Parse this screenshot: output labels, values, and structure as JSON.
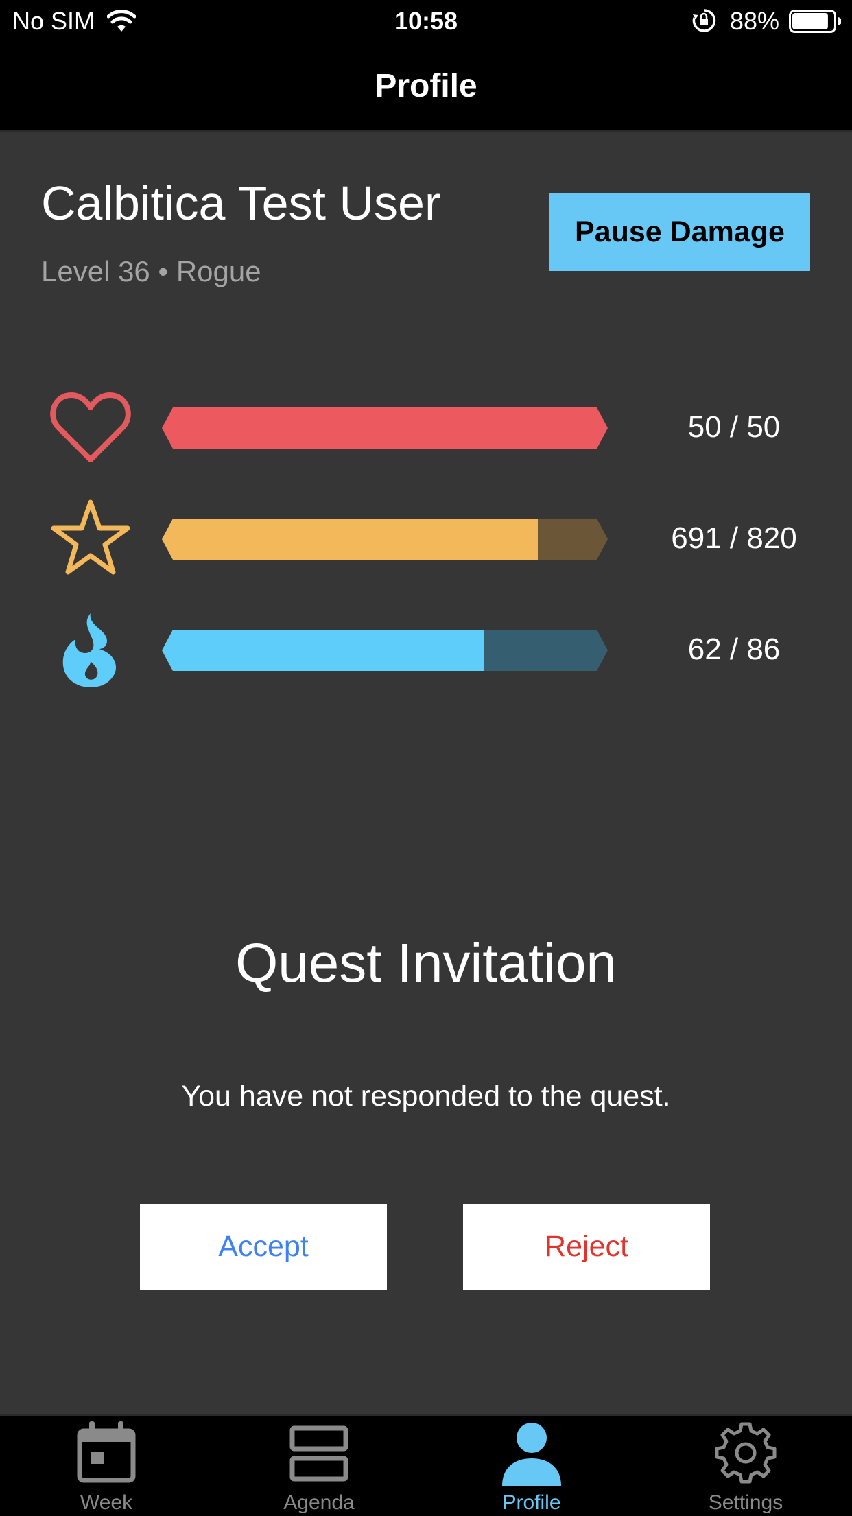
{
  "status_bar": {
    "carrier": "No SIM",
    "time": "10:58",
    "battery_percent": "88%",
    "battery_level": 0.88
  },
  "nav": {
    "title": "Profile"
  },
  "profile": {
    "name": "Calbitica Test User",
    "subtitle": "Level 36 • Rogue",
    "pause_button": "Pause Damage"
  },
  "stats": [
    {
      "icon": "heart-icon",
      "label": "50 / 50",
      "current": 50,
      "max": 50,
      "color": "#ec5a60",
      "track_color": "#6e3436"
    },
    {
      "icon": "star-icon",
      "label": "691 / 820",
      "current": 691,
      "max": 820,
      "color": "#f3b85a",
      "track_color": "#6b5637"
    },
    {
      "icon": "flame-icon",
      "label": "62 / 86",
      "current": 62,
      "max": 86,
      "color": "#5fcdf9",
      "track_color": "#355f70"
    }
  ],
  "quest": {
    "title": "Quest Invitation",
    "message": "You have not responded to the quest.",
    "accept_label": "Accept",
    "reject_label": "Reject",
    "accept_color": "#3d82f0",
    "reject_color": "#e0352d"
  },
  "tabs": [
    {
      "label": "Week",
      "icon": "calendar-icon",
      "active": false
    },
    {
      "label": "Agenda",
      "icon": "agenda-icon",
      "active": false
    },
    {
      "label": "Profile",
      "icon": "person-icon",
      "active": true
    },
    {
      "label": "Settings",
      "icon": "gear-icon",
      "active": false
    }
  ],
  "colors": {
    "accent": "#67c8f5",
    "background": "#363636",
    "bars_background": "#000000"
  }
}
